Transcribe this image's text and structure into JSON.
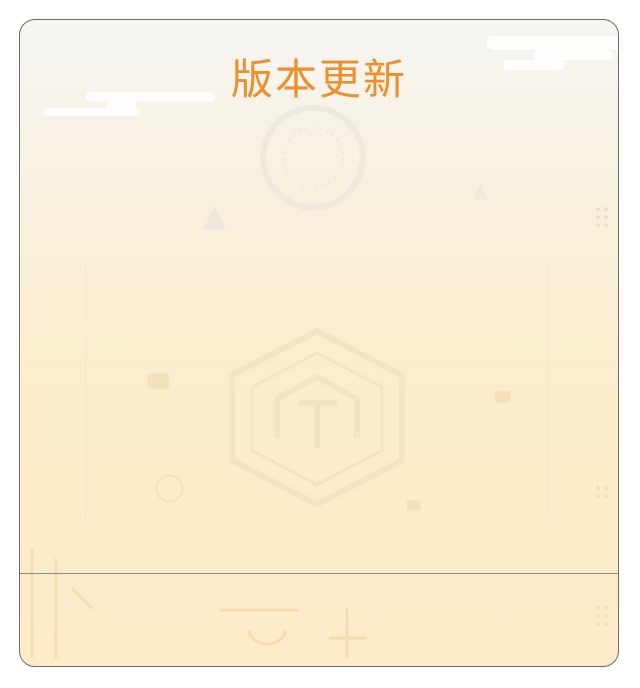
{
  "dialog": {
    "title": "版本更新"
  },
  "colors": {
    "title": "#ec8f2c",
    "background_top": "#f6f5f3",
    "background_bottom": "#fdebc9",
    "border": "#6b6b6b"
  },
  "icons": {
    "watermark": "tech-house-logo-icon"
  }
}
